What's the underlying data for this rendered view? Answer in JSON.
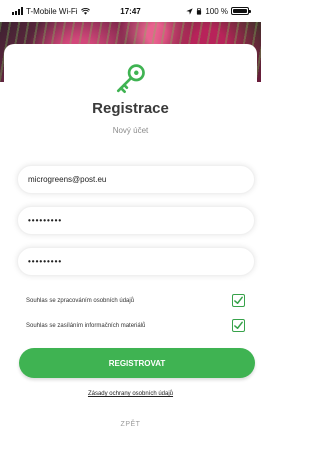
{
  "status_bar": {
    "carrier": "T-Mobile Wi-Fi",
    "time": "17:47",
    "battery": "100 %"
  },
  "header": {
    "icon": "key-icon",
    "title": "Registrace",
    "subtitle": "Nový účet"
  },
  "form": {
    "email": {
      "value": "microgreens@post.eu"
    },
    "password": {
      "value": "•••••••••"
    },
    "password_confirm": {
      "value": "•••••••••"
    }
  },
  "consents": [
    {
      "label": "Souhlas se zpracováním osobních údajů",
      "checked": true
    },
    {
      "label": "Souhlas se zasíláním informačních materiálů",
      "checked": true
    }
  ],
  "actions": {
    "register_label": "REGISTROVAT",
    "policy_link": "Zásady ochrany osobních údajů",
    "back_label": "ZPĚT"
  },
  "colors": {
    "accent": "#3fb352",
    "title": "#3a3a3a",
    "muted": "#8b8b8b"
  }
}
